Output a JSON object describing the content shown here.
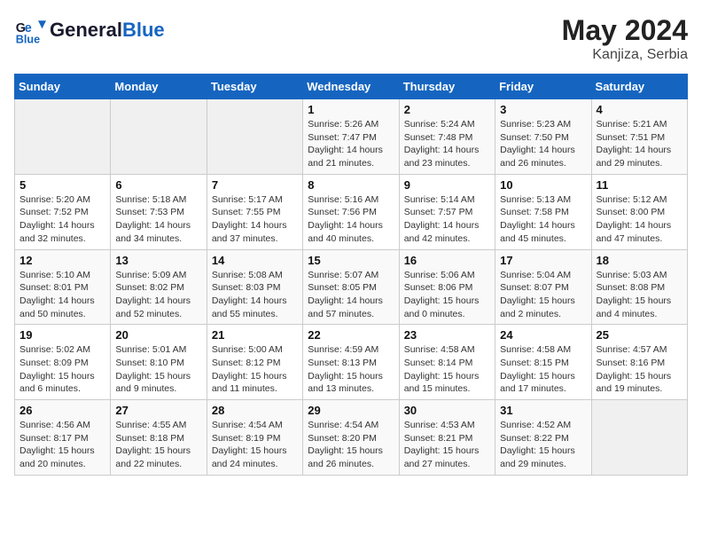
{
  "header": {
    "logo_line1": "General",
    "logo_line2": "Blue",
    "month_year": "May 2024",
    "location": "Kanjiza, Serbia"
  },
  "weekdays": [
    "Sunday",
    "Monday",
    "Tuesday",
    "Wednesday",
    "Thursday",
    "Friday",
    "Saturday"
  ],
  "weeks": [
    [
      {
        "day": "",
        "sunrise": "",
        "sunset": "",
        "daylight": ""
      },
      {
        "day": "",
        "sunrise": "",
        "sunset": "",
        "daylight": ""
      },
      {
        "day": "",
        "sunrise": "",
        "sunset": "",
        "daylight": ""
      },
      {
        "day": "1",
        "sunrise": "Sunrise: 5:26 AM",
        "sunset": "Sunset: 7:47 PM",
        "daylight": "Daylight: 14 hours and 21 minutes."
      },
      {
        "day": "2",
        "sunrise": "Sunrise: 5:24 AM",
        "sunset": "Sunset: 7:48 PM",
        "daylight": "Daylight: 14 hours and 23 minutes."
      },
      {
        "day": "3",
        "sunrise": "Sunrise: 5:23 AM",
        "sunset": "Sunset: 7:50 PM",
        "daylight": "Daylight: 14 hours and 26 minutes."
      },
      {
        "day": "4",
        "sunrise": "Sunrise: 5:21 AM",
        "sunset": "Sunset: 7:51 PM",
        "daylight": "Daylight: 14 hours and 29 minutes."
      }
    ],
    [
      {
        "day": "5",
        "sunrise": "Sunrise: 5:20 AM",
        "sunset": "Sunset: 7:52 PM",
        "daylight": "Daylight: 14 hours and 32 minutes."
      },
      {
        "day": "6",
        "sunrise": "Sunrise: 5:18 AM",
        "sunset": "Sunset: 7:53 PM",
        "daylight": "Daylight: 14 hours and 34 minutes."
      },
      {
        "day": "7",
        "sunrise": "Sunrise: 5:17 AM",
        "sunset": "Sunset: 7:55 PM",
        "daylight": "Daylight: 14 hours and 37 minutes."
      },
      {
        "day": "8",
        "sunrise": "Sunrise: 5:16 AM",
        "sunset": "Sunset: 7:56 PM",
        "daylight": "Daylight: 14 hours and 40 minutes."
      },
      {
        "day": "9",
        "sunrise": "Sunrise: 5:14 AM",
        "sunset": "Sunset: 7:57 PM",
        "daylight": "Daylight: 14 hours and 42 minutes."
      },
      {
        "day": "10",
        "sunrise": "Sunrise: 5:13 AM",
        "sunset": "Sunset: 7:58 PM",
        "daylight": "Daylight: 14 hours and 45 minutes."
      },
      {
        "day": "11",
        "sunrise": "Sunrise: 5:12 AM",
        "sunset": "Sunset: 8:00 PM",
        "daylight": "Daylight: 14 hours and 47 minutes."
      }
    ],
    [
      {
        "day": "12",
        "sunrise": "Sunrise: 5:10 AM",
        "sunset": "Sunset: 8:01 PM",
        "daylight": "Daylight: 14 hours and 50 minutes."
      },
      {
        "day": "13",
        "sunrise": "Sunrise: 5:09 AM",
        "sunset": "Sunset: 8:02 PM",
        "daylight": "Daylight: 14 hours and 52 minutes."
      },
      {
        "day": "14",
        "sunrise": "Sunrise: 5:08 AM",
        "sunset": "Sunset: 8:03 PM",
        "daylight": "Daylight: 14 hours and 55 minutes."
      },
      {
        "day": "15",
        "sunrise": "Sunrise: 5:07 AM",
        "sunset": "Sunset: 8:05 PM",
        "daylight": "Daylight: 14 hours and 57 minutes."
      },
      {
        "day": "16",
        "sunrise": "Sunrise: 5:06 AM",
        "sunset": "Sunset: 8:06 PM",
        "daylight": "Daylight: 15 hours and 0 minutes."
      },
      {
        "day": "17",
        "sunrise": "Sunrise: 5:04 AM",
        "sunset": "Sunset: 8:07 PM",
        "daylight": "Daylight: 15 hours and 2 minutes."
      },
      {
        "day": "18",
        "sunrise": "Sunrise: 5:03 AM",
        "sunset": "Sunset: 8:08 PM",
        "daylight": "Daylight: 15 hours and 4 minutes."
      }
    ],
    [
      {
        "day": "19",
        "sunrise": "Sunrise: 5:02 AM",
        "sunset": "Sunset: 8:09 PM",
        "daylight": "Daylight: 15 hours and 6 minutes."
      },
      {
        "day": "20",
        "sunrise": "Sunrise: 5:01 AM",
        "sunset": "Sunset: 8:10 PM",
        "daylight": "Daylight: 15 hours and 9 minutes."
      },
      {
        "day": "21",
        "sunrise": "Sunrise: 5:00 AM",
        "sunset": "Sunset: 8:12 PM",
        "daylight": "Daylight: 15 hours and 11 minutes."
      },
      {
        "day": "22",
        "sunrise": "Sunrise: 4:59 AM",
        "sunset": "Sunset: 8:13 PM",
        "daylight": "Daylight: 15 hours and 13 minutes."
      },
      {
        "day": "23",
        "sunrise": "Sunrise: 4:58 AM",
        "sunset": "Sunset: 8:14 PM",
        "daylight": "Daylight: 15 hours and 15 minutes."
      },
      {
        "day": "24",
        "sunrise": "Sunrise: 4:58 AM",
        "sunset": "Sunset: 8:15 PM",
        "daylight": "Daylight: 15 hours and 17 minutes."
      },
      {
        "day": "25",
        "sunrise": "Sunrise: 4:57 AM",
        "sunset": "Sunset: 8:16 PM",
        "daylight": "Daylight: 15 hours and 19 minutes."
      }
    ],
    [
      {
        "day": "26",
        "sunrise": "Sunrise: 4:56 AM",
        "sunset": "Sunset: 8:17 PM",
        "daylight": "Daylight: 15 hours and 20 minutes."
      },
      {
        "day": "27",
        "sunrise": "Sunrise: 4:55 AM",
        "sunset": "Sunset: 8:18 PM",
        "daylight": "Daylight: 15 hours and 22 minutes."
      },
      {
        "day": "28",
        "sunrise": "Sunrise: 4:54 AM",
        "sunset": "Sunset: 8:19 PM",
        "daylight": "Daylight: 15 hours and 24 minutes."
      },
      {
        "day": "29",
        "sunrise": "Sunrise: 4:54 AM",
        "sunset": "Sunset: 8:20 PM",
        "daylight": "Daylight: 15 hours and 26 minutes."
      },
      {
        "day": "30",
        "sunrise": "Sunrise: 4:53 AM",
        "sunset": "Sunset: 8:21 PM",
        "daylight": "Daylight: 15 hours and 27 minutes."
      },
      {
        "day": "31",
        "sunrise": "Sunrise: 4:52 AM",
        "sunset": "Sunset: 8:22 PM",
        "daylight": "Daylight: 15 hours and 29 minutes."
      },
      {
        "day": "",
        "sunrise": "",
        "sunset": "",
        "daylight": ""
      }
    ]
  ]
}
